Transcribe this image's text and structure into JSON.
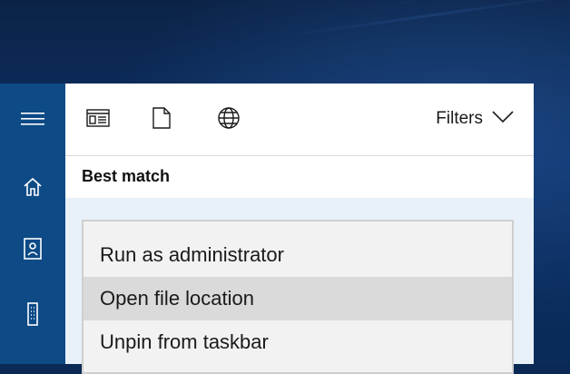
{
  "rail": {
    "icons": [
      "hamburger-menu-icon",
      "home-icon",
      "notebook-icon",
      "device-icon"
    ]
  },
  "scope_bar": {
    "icons": [
      "apps-scope-icon",
      "documents-scope-icon",
      "web-scope-icon"
    ],
    "filters_label": "Filters"
  },
  "best_match": {
    "heading": "Best match"
  },
  "context_menu": {
    "items": [
      {
        "label": "Run as administrator"
      },
      {
        "label": "Open file location"
      },
      {
        "label": "Unpin from taskbar"
      }
    ],
    "highlighted_index": 1
  },
  "colors": {
    "rail": "#0d4a86",
    "panel": "#ffffff",
    "result_area": "#e8f1f9",
    "menu": "#f2f2f2",
    "menu_hover": "#dadada"
  }
}
